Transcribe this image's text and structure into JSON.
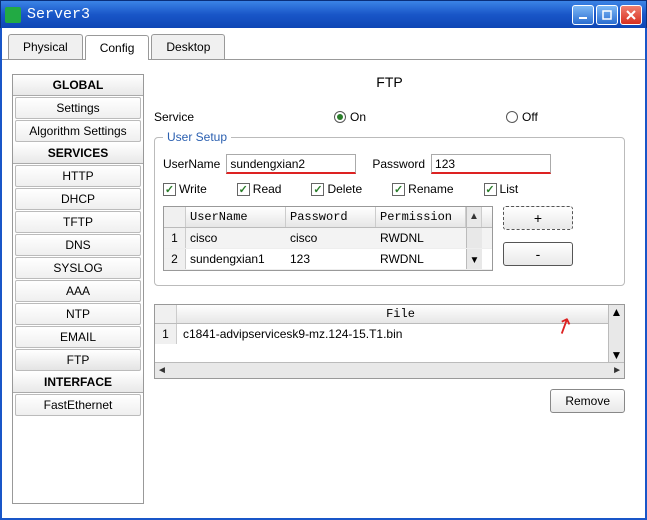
{
  "window": {
    "title": "Server3"
  },
  "tabs": {
    "physical": "Physical",
    "config": "Config",
    "desktop": "Desktop",
    "active": "config"
  },
  "sidebar": {
    "global_header": "GLOBAL",
    "global_items": [
      "Settings",
      "Algorithm Settings"
    ],
    "services_header": "SERVICES",
    "services_items": [
      "HTTP",
      "DHCP",
      "TFTP",
      "DNS",
      "SYSLOG",
      "AAA",
      "NTP",
      "EMAIL",
      "FTP"
    ],
    "interface_header": "INTERFACE",
    "interface_items": [
      "FastEthernet"
    ],
    "selected": "FTP"
  },
  "panel": {
    "title": "FTP",
    "service_label": "Service",
    "on_label": "On",
    "off_label": "Off",
    "service_state": "on"
  },
  "user_setup": {
    "legend": "User Setup",
    "username_label": "UserName",
    "username_value": "sundengxian2",
    "password_label": "Password",
    "password_value": "123",
    "perms": {
      "write": "Write",
      "read": "Read",
      "delete": "Delete",
      "rename": "Rename",
      "list": "List"
    },
    "perms_checked": {
      "write": true,
      "read": true,
      "delete": true,
      "rename": true,
      "list": true
    }
  },
  "user_table": {
    "headers": {
      "username": "UserName",
      "password": "Password",
      "permission": "Permission"
    },
    "rows": [
      {
        "idx": "1",
        "username": "cisco",
        "password": "cisco",
        "permission": "RWDNL"
      },
      {
        "idx": "2",
        "username": "sundengxian1",
        "password": "123",
        "permission": "RWDNL"
      }
    ]
  },
  "buttons": {
    "add": "+",
    "remove_user": "-",
    "remove_file": "Remove"
  },
  "file_table": {
    "header": "File",
    "rows": [
      {
        "idx": "1",
        "name": "c1841-advipservicesk9-mz.124-15.T1.bin"
      }
    ]
  }
}
